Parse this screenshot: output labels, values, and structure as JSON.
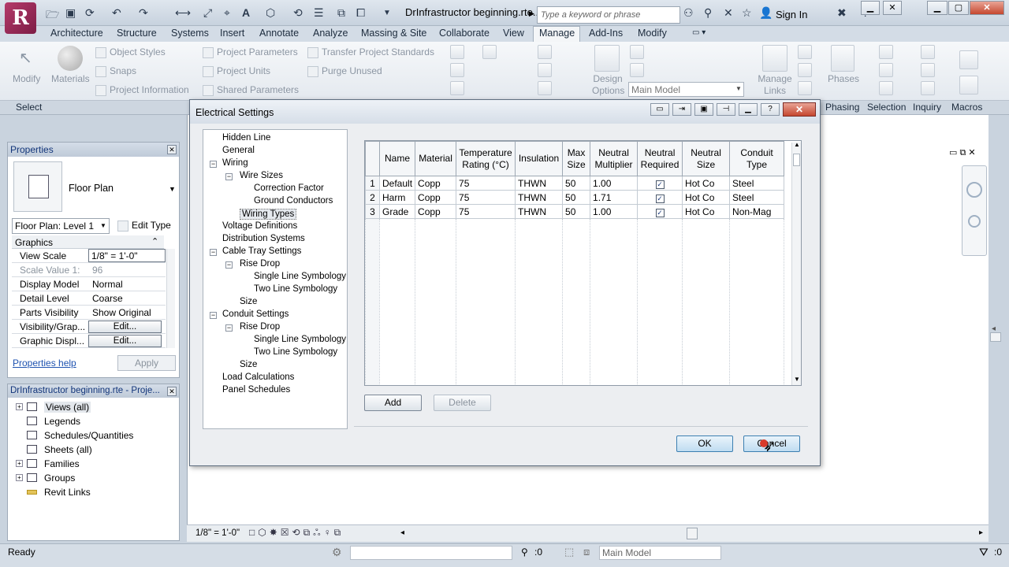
{
  "app": {
    "logo_letter": "R",
    "doc_title": "DrInfrastructor beginning.rte...",
    "search_placeholder": "Type a keyword or phrase",
    "sign_in": "Sign In"
  },
  "ribbon": {
    "tabs": [
      "Architecture",
      "Structure",
      "Systems",
      "Insert",
      "Annotate",
      "Analyze",
      "Massing & Site",
      "Collaborate",
      "View",
      "Manage",
      "Add-Ins",
      "Modify"
    ],
    "active_tab": "Manage",
    "modify_label": "Modify",
    "materials_label": "Materials",
    "settings_items": [
      "Object Styles",
      "Snaps",
      "Project Information",
      "Project Parameters",
      "Project Units",
      "Shared Parameters",
      "Transfer Project Standards",
      "Purge Unused"
    ],
    "design_options_label": "Design Options",
    "main_model": "Main Model",
    "manage_links_label": "Manage Links",
    "phases_label": "Phases",
    "panel_labels": [
      "Select",
      "Phasing",
      "Selection",
      "Inquiry",
      "Macros"
    ]
  },
  "properties": {
    "title": "Properties",
    "type_name": "Floor Plan",
    "instance_selector": "Floor Plan: Level 1",
    "edit_type": "Edit Type",
    "group": "Graphics",
    "rows": [
      {
        "key": "View Scale",
        "value": "1/8\" = 1'-0\""
      },
      {
        "key": "Scale Value    1:",
        "value": "96"
      },
      {
        "key": "Display Model",
        "value": "Normal"
      },
      {
        "key": "Detail Level",
        "value": "Coarse"
      },
      {
        "key": "Parts Visibility",
        "value": "Show Original"
      },
      {
        "key": "Visibility/Grap...",
        "value": "Edit..."
      },
      {
        "key": "Graphic Displ...",
        "value": "Edit..."
      }
    ],
    "help": "Properties help",
    "apply": "Apply"
  },
  "browser": {
    "title": "DrInfrastructor beginning.rte - Proje...",
    "items": [
      "Views (all)",
      "Legends",
      "Schedules/Quantities",
      "Sheets (all)",
      "Families",
      "Groups",
      "Revit Links"
    ]
  },
  "viewbar": {
    "scale": "1/8\" = 1'-0\""
  },
  "status": {
    "text": "Ready",
    "filter_count": ":0",
    "model": "Main Model"
  },
  "dialog": {
    "title": "Electrical Settings",
    "tree": [
      {
        "label": "Hidden Line",
        "level": 0
      },
      {
        "label": "General",
        "level": 0
      },
      {
        "label": "Wiring",
        "level": 0
      },
      {
        "label": "Wire Sizes",
        "level": 1
      },
      {
        "label": "Correction Factor",
        "level": 2
      },
      {
        "label": "Ground Conductors",
        "level": 2
      },
      {
        "label": "Wiring Types",
        "level": 1
      },
      {
        "label": "Voltage Definitions",
        "level": 0
      },
      {
        "label": "Distribution Systems",
        "level": 0
      },
      {
        "label": "Cable Tray Settings",
        "level": 0
      },
      {
        "label": "Rise Drop",
        "level": 1
      },
      {
        "label": "Single Line Symbology",
        "level": 2
      },
      {
        "label": "Two Line Symbology",
        "level": 2
      },
      {
        "label": "Size",
        "level": 1
      },
      {
        "label": "Conduit Settings",
        "level": 0
      },
      {
        "label": "Rise Drop",
        "level": 1
      },
      {
        "label": "Single Line Symbology",
        "level": 2
      },
      {
        "label": "Two Line Symbology",
        "level": 2
      },
      {
        "label": "Size",
        "level": 1
      },
      {
        "label": "Load Calculations",
        "level": 0
      },
      {
        "label": "Panel Schedules",
        "level": 0
      }
    ],
    "selected_tree": "Wiring Types",
    "columns": [
      "Name",
      "Material",
      "Temperature Rating (°C)",
      "Insulation",
      "Max Size",
      "Neutral Multiplier",
      "Neutral Required",
      "Neutral Size",
      "Conduit Type"
    ],
    "rows": [
      {
        "n": "1",
        "name": "Default",
        "material": "Copp",
        "temp": "75",
        "insulation": "THWN",
        "max_size": "50",
        "multiplier": "1.00",
        "required": true,
        "neutral_size": "Hot Co",
        "conduit": "Steel"
      },
      {
        "n": "2",
        "name": "Harm",
        "material": "Copp",
        "temp": "75",
        "insulation": "THWN",
        "max_size": "50",
        "multiplier": "1.71",
        "required": true,
        "neutral_size": "Hot Co",
        "conduit": "Steel"
      },
      {
        "n": "3",
        "name": "Grade",
        "material": "Copp",
        "temp": "75",
        "insulation": "THWN",
        "max_size": "50",
        "multiplier": "1.00",
        "required": true,
        "neutral_size": "Hot Co",
        "conduit": "Non-Mag"
      }
    ],
    "add": "Add",
    "delete": "Delete",
    "ok": "OK",
    "cancel": "Cancel"
  }
}
